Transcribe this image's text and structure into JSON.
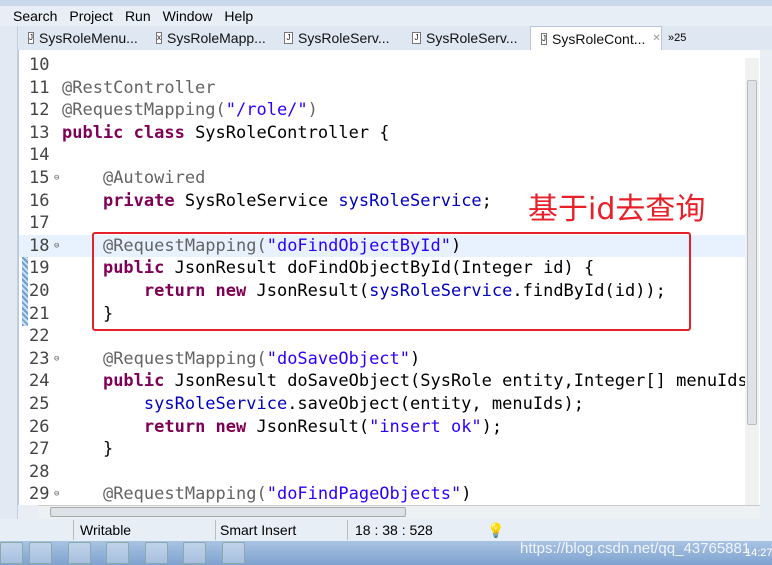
{
  "menu": [
    "Search",
    "Project",
    "Run",
    "Window",
    "Help"
  ],
  "tabs": [
    {
      "label": "SysRoleMenu...",
      "icon": "java-file-icon"
    },
    {
      "label": "SysRoleMapp...",
      "icon": "xml-file-icon"
    },
    {
      "label": "SysRoleServ...",
      "icon": "java-file-icon"
    },
    {
      "label": "SysRoleServ...",
      "icon": "java-file-icon"
    },
    {
      "label": "SysRoleCont...",
      "icon": "java-file-icon",
      "active": true
    }
  ],
  "tab_overflow": "»25",
  "code_lines": [
    {
      "n": "10",
      "t": []
    },
    {
      "n": "11",
      "t": [
        [
          "a",
          "@RestController"
        ]
      ]
    },
    {
      "n": "12",
      "t": [
        [
          "a",
          "@RequestMapping("
        ],
        [
          "s",
          "\"/role/\""
        ],
        [
          "a",
          ")"
        ]
      ]
    },
    {
      "n": "13",
      "t": [
        [
          "k",
          "public class "
        ],
        [
          "",
          "SysRoleController {"
        ]
      ]
    },
    {
      "n": "14",
      "t": []
    },
    {
      "n": "15",
      "fold": true,
      "t": [
        [
          "",
          "    "
        ],
        [
          "a",
          "@Autowired"
        ]
      ]
    },
    {
      "n": "16",
      "t": [
        [
          "",
          "    "
        ],
        [
          "k",
          "private "
        ],
        [
          "",
          "SysRoleService "
        ],
        [
          "f",
          "sysRoleService"
        ],
        [
          "",
          ";"
        ]
      ]
    },
    {
      "n": "17",
      "t": []
    },
    {
      "n": "18",
      "fold": true,
      "cur": true,
      "t": [
        [
          "",
          "    "
        ],
        [
          "a",
          "@RequestMapping("
        ],
        [
          "s",
          "\"doFindObjectById\""
        ],
        [
          "",
          ")"
        ]
      ]
    },
    {
      "n": "19",
      "t": [
        [
          "",
          "    "
        ],
        [
          "k",
          "public "
        ],
        [
          "",
          "JsonResult doFindObjectById(Integer id) {"
        ]
      ]
    },
    {
      "n": "20",
      "t": [
        [
          "",
          "        "
        ],
        [
          "k",
          "return new "
        ],
        [
          "",
          "JsonResult("
        ],
        [
          "f",
          "sysRoleService"
        ],
        [
          "",
          ".findById(id));"
        ]
      ]
    },
    {
      "n": "21",
      "t": [
        [
          "",
          "    }"
        ]
      ]
    },
    {
      "n": "22",
      "t": []
    },
    {
      "n": "23",
      "fold": true,
      "t": [
        [
          "",
          "    "
        ],
        [
          "a",
          "@RequestMapping("
        ],
        [
          "s",
          "\"doSaveObject\""
        ],
        [
          "",
          ")"
        ]
      ]
    },
    {
      "n": "24",
      "t": [
        [
          "",
          "    "
        ],
        [
          "k",
          "public "
        ],
        [
          "",
          "JsonResult doSaveObject(SysRole entity,Integer[] menuIds"
        ]
      ]
    },
    {
      "n": "25",
      "t": [
        [
          "",
          "        "
        ],
        [
          "f",
          "sysRoleService"
        ],
        [
          "",
          ".saveObject(entity, menuIds);"
        ]
      ]
    },
    {
      "n": "26",
      "t": [
        [
          "",
          "        "
        ],
        [
          "k",
          "return new "
        ],
        [
          "",
          "JsonResult("
        ],
        [
          "s",
          "\"insert ok\""
        ],
        [
          "",
          ");"
        ]
      ]
    },
    {
      "n": "27",
      "t": [
        [
          "",
          "    }"
        ]
      ]
    },
    {
      "n": "28",
      "t": []
    },
    {
      "n": "29",
      "fold": true,
      "t": [
        [
          "",
          "    "
        ],
        [
          "a",
          "@RequestMapping("
        ],
        [
          "s",
          "\"doFindPageObjects\""
        ],
        [
          "",
          ")"
        ]
      ]
    }
  ],
  "annotation": {
    "text": "基于id去查询",
    "color": "#e8202a"
  },
  "status": {
    "writable": "Writable",
    "insert_mode": "Smart Insert",
    "position": "18 : 38 : 528"
  },
  "watermark": "https://blog.csdn.net/qq_43765881",
  "clock": "14:27"
}
